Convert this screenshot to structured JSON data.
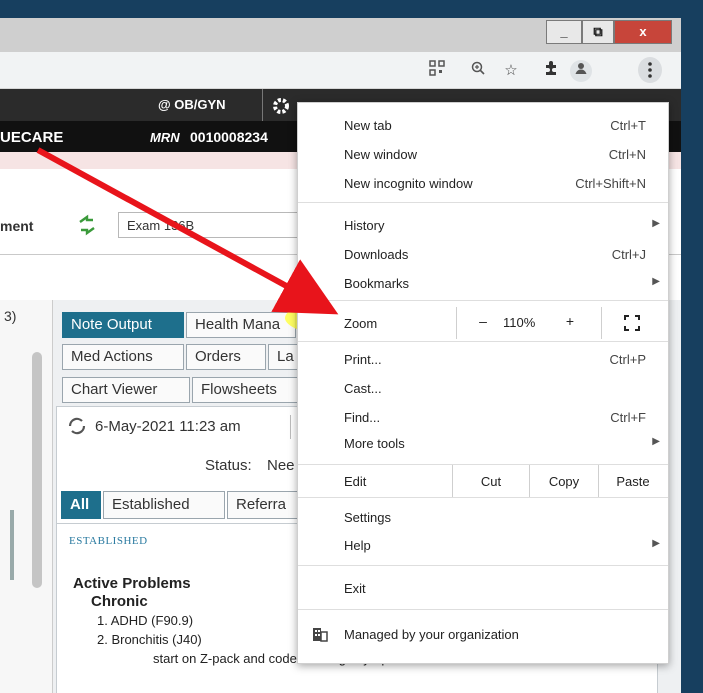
{
  "window": {
    "minimize": "_",
    "restore": "⧉",
    "close": "x"
  },
  "toolbar": {
    "icons": [
      "qr-code-icon",
      "zoom-icon",
      "star-icon",
      "extensions-icon",
      "profile-icon",
      "menu-dots-icon"
    ]
  },
  "app": {
    "dept": "@ OB/GYN",
    "patient_frag": "UECARE",
    "mrn_label": "MRN",
    "mrn": "0010008234",
    "encounter_frag": "ment",
    "location": "Exam 136B"
  },
  "tabs_row1": [
    "Note Output",
    "Health Mana"
  ],
  "tabs_row2": [
    "Med Actions",
    "Orders",
    "La"
  ],
  "tabs_row3": [
    "Chart Viewer",
    "Flowsheets"
  ],
  "timestamp": "6-May-2021 11:23 am",
  "status_label": "Status:",
  "status_value": "Nee",
  "filter_tabs": [
    "All",
    "Established",
    "Referra"
  ],
  "left_panel_frag": "3)",
  "note": {
    "section": "Established",
    "heading": "Active Problems",
    "subheading": "Chronic",
    "item1": "1. ADHD (F90.9)",
    "item2": "2. Bronchitis (J40)",
    "item2_note": "start on Z-pack and codeine cough syrup"
  },
  "menu": {
    "new_tab": "New tab",
    "new_tab_sc": "Ctrl+T",
    "new_window": "New window",
    "new_window_sc": "Ctrl+N",
    "incognito": "New incognito window",
    "incognito_sc": "Ctrl+Shift+N",
    "history": "History",
    "downloads": "Downloads",
    "downloads_sc": "Ctrl+J",
    "bookmarks": "Bookmarks",
    "zoom": "Zoom",
    "zoom_minus": "–",
    "zoom_value": "110%",
    "zoom_plus": "+",
    "print": "Print...",
    "print_sc": "Ctrl+P",
    "cast": "Cast...",
    "find": "Find...",
    "find_sc": "Ctrl+F",
    "more_tools": "More tools",
    "edit": "Edit",
    "cut": "Cut",
    "copy": "Copy",
    "paste": "Paste",
    "settings": "Settings",
    "help": "Help",
    "exit": "Exit",
    "managed": "Managed by your organization"
  },
  "colors": {
    "background": "#173f5f",
    "tab_active": "#1e6f8c",
    "highlight": "#ffff46",
    "arrow": "#e8141b"
  }
}
